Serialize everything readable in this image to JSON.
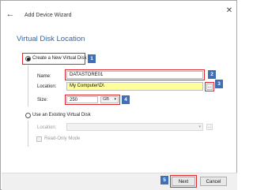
{
  "window": {
    "title": "Add Device Wizard"
  },
  "page": {
    "title": "Virtual Disk Location"
  },
  "icons": {
    "back": "back-arrow-icon",
    "close": "close-icon"
  },
  "options": {
    "create_new": {
      "label": "Create a New Virtual Disk",
      "selected": true,
      "name_label": "Name:",
      "name_value": "DATASTORE01",
      "location_label": "Location:",
      "location_value": "My Computer\\D\\",
      "browse_label": "...",
      "size_label": "Size:",
      "size_value": "250",
      "size_unit": "GB"
    },
    "use_existing": {
      "label": "Use an Existing Virtual Disk",
      "selected": false,
      "location_label": "Location:",
      "location_value": "",
      "browse_label": "...",
      "readonly_label": "Read-Only Mode",
      "readonly_checked": false
    }
  },
  "callouts": [
    "1",
    "2",
    "3",
    "4",
    "5"
  ],
  "footer": {
    "next_label": "Next",
    "cancel_label": "Cancel"
  },
  "colors": {
    "accent": "#2a67b1",
    "callout_border": "#e0262a",
    "badge": "#3f6fb6",
    "highlight": "#fefe9a"
  }
}
